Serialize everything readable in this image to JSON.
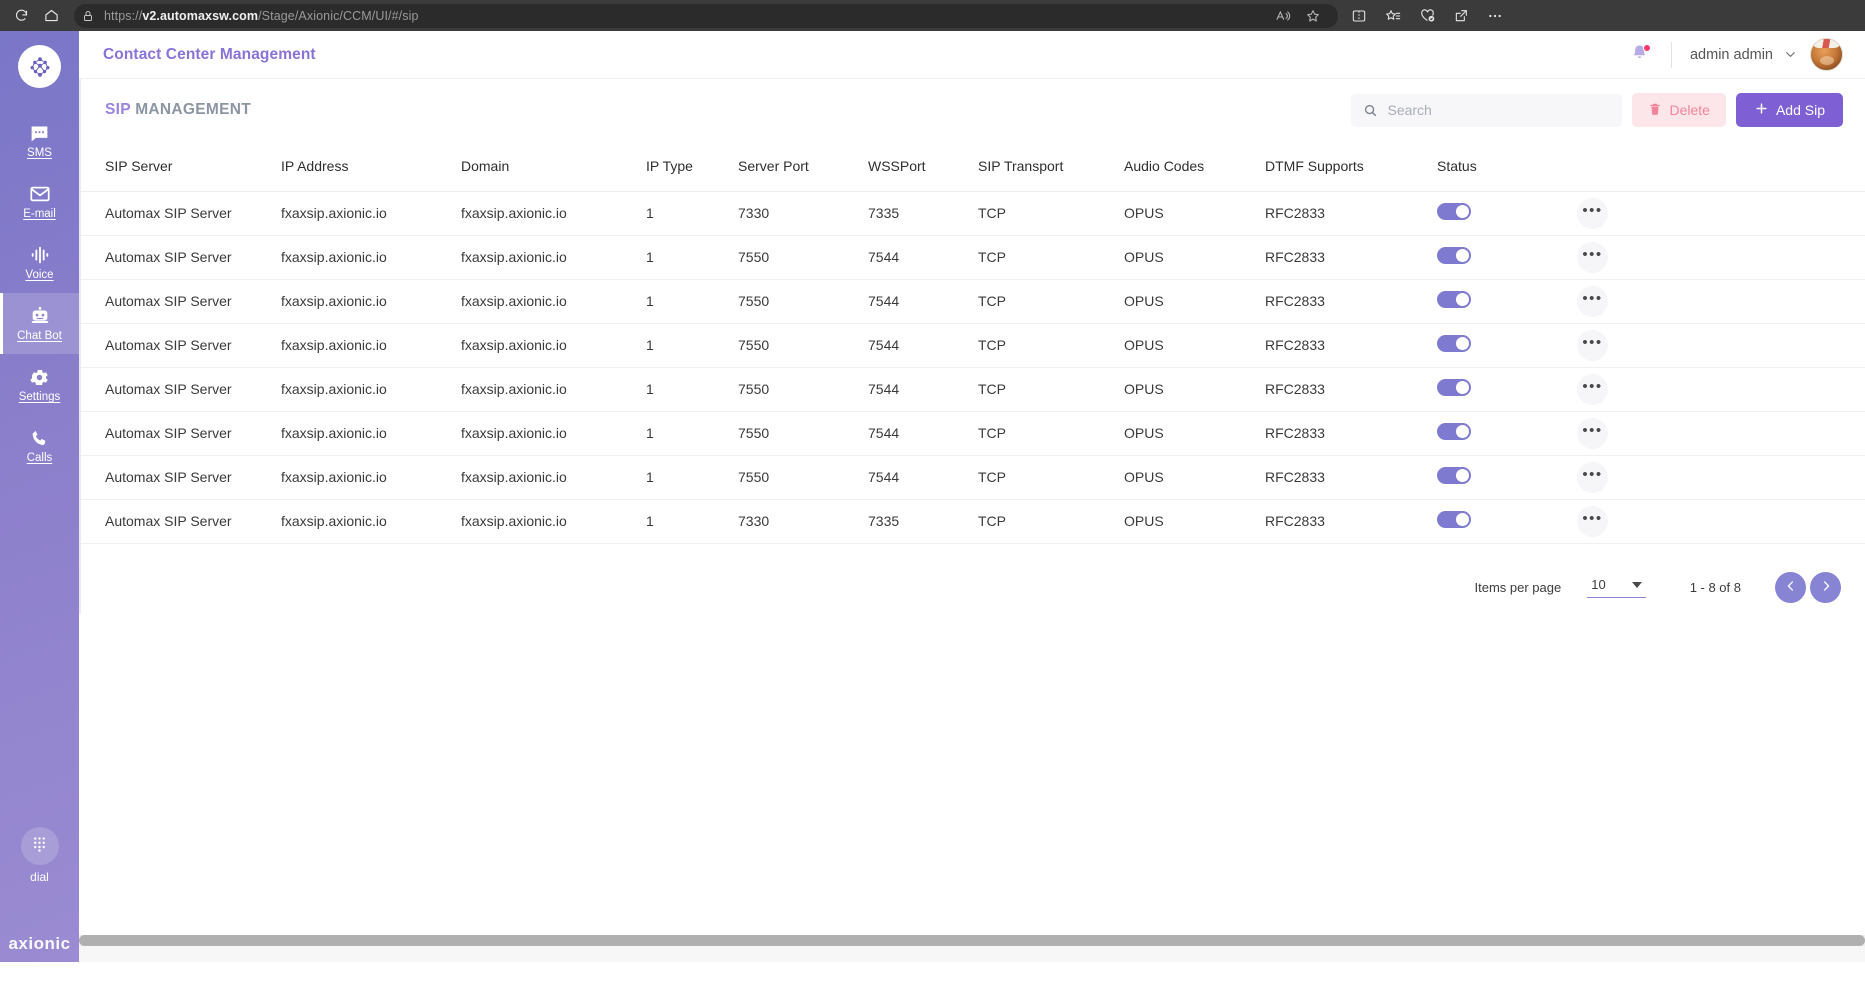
{
  "browser": {
    "url_scheme": "https://",
    "url_host": "v2.automaxsw.com",
    "url_path": "/Stage/Axionic/CCM/UI/#/sip",
    "icons": {
      "refresh": "refresh-icon",
      "home": "home-icon",
      "lock": "lock-icon",
      "read_aloud": "read-aloud-icon",
      "favorite": "star-icon",
      "split_screen": "split-screen-icon",
      "favorites_list": "favorites-list-icon",
      "collections": "collections-icon",
      "share": "share-icon",
      "settings_more": "ellipsis-icon"
    }
  },
  "sidebar": {
    "logo": "axionic-logo-icon",
    "items": [
      {
        "label": "SMS",
        "icon": "sms-icon",
        "active": false
      },
      {
        "label": "E-mail",
        "icon": "email-icon",
        "active": false
      },
      {
        "label": "Voice",
        "icon": "voice-waveform-icon",
        "active": false
      },
      {
        "label": "Chat Bot",
        "icon": "robot-icon",
        "active": true
      },
      {
        "label": "Settings",
        "icon": "gear-icon",
        "active": false
      },
      {
        "label": "Calls",
        "icon": "phone-icon",
        "active": false
      }
    ],
    "dial_label": "dial",
    "dial_icon": "keypad-icon",
    "footer_logo": "axionic"
  },
  "header": {
    "title": "Contact Center Management",
    "bell_icon": "bell-icon",
    "user_name": "admin admin",
    "chevron_icon": "chevron-down-icon",
    "avatar": "cat-avatar"
  },
  "toolbar": {
    "title_accent": "SIP",
    "title_plain": "MANAGEMENT",
    "search_placeholder": "Search",
    "search_value": "",
    "search_icon": "search-icon",
    "delete_label": "Delete",
    "delete_icon": "trash-icon",
    "add_label": "Add Sip",
    "add_icon": "plus-icon"
  },
  "table": {
    "columns": [
      "SIP Server",
      "IP Address",
      "Domain",
      "IP Type",
      "Server Port",
      "WSSPort",
      "SIP Transport",
      "Audio Codes",
      "DTMF Supports",
      "Status"
    ],
    "rows": [
      {
        "server": "Automax SIP Server",
        "ip": "fxaxsip.axionic.io",
        "domain": "fxaxsip.axionic.io",
        "iptype": "1",
        "port": "7330",
        "wss": "7335",
        "transport": "TCP",
        "audio": "OPUS",
        "dtmf": "RFC2833",
        "status": true
      },
      {
        "server": "Automax SIP Server",
        "ip": "fxaxsip.axionic.io",
        "domain": "fxaxsip.axionic.io",
        "iptype": "1",
        "port": "7550",
        "wss": "7544",
        "transport": "TCP",
        "audio": "OPUS",
        "dtmf": "RFC2833",
        "status": true
      },
      {
        "server": "Automax SIP Server",
        "ip": "fxaxsip.axionic.io",
        "domain": "fxaxsip.axionic.io",
        "iptype": "1",
        "port": "7550",
        "wss": "7544",
        "transport": "TCP",
        "audio": "OPUS",
        "dtmf": "RFC2833",
        "status": true
      },
      {
        "server": "Automax SIP Server",
        "ip": "fxaxsip.axionic.io",
        "domain": "fxaxsip.axionic.io",
        "iptype": "1",
        "port": "7550",
        "wss": "7544",
        "transport": "TCP",
        "audio": "OPUS",
        "dtmf": "RFC2833",
        "status": true
      },
      {
        "server": "Automax SIP Server",
        "ip": "fxaxsip.axionic.io",
        "domain": "fxaxsip.axionic.io",
        "iptype": "1",
        "port": "7550",
        "wss": "7544",
        "transport": "TCP",
        "audio": "OPUS",
        "dtmf": "RFC2833",
        "status": true
      },
      {
        "server": "Automax SIP Server",
        "ip": "fxaxsip.axionic.io",
        "domain": "fxaxsip.axionic.io",
        "iptype": "1",
        "port": "7550",
        "wss": "7544",
        "transport": "TCP",
        "audio": "OPUS",
        "dtmf": "RFC2833",
        "status": true
      },
      {
        "server": "Automax SIP Server",
        "ip": "fxaxsip.axionic.io",
        "domain": "fxaxsip.axionic.io",
        "iptype": "1",
        "port": "7550",
        "wss": "7544",
        "transport": "TCP",
        "audio": "OPUS",
        "dtmf": "RFC2833",
        "status": true
      },
      {
        "server": "Automax SIP Server",
        "ip": "fxaxsip.axionic.io",
        "domain": "fxaxsip.axionic.io",
        "iptype": "1",
        "port": "7330",
        "wss": "7335",
        "transport": "TCP",
        "audio": "OPUS",
        "dtmf": "RFC2833",
        "status": true
      }
    ],
    "row_menu_icon": "ellipsis-icon"
  },
  "paginator": {
    "items_per_page_label": "Items per page",
    "page_size": "10",
    "range_label": "1 - 8 of 8",
    "prev_icon": "chevron-left-icon",
    "next_icon": "chevron-right-icon"
  },
  "colors": {
    "accent_purple": "#7e5fd4",
    "title_purple": "#9a82dd",
    "delete_pink": "#f2849a",
    "toggle_on": "#7e7ad0",
    "sidebar_gradient_start": "#7a76c8",
    "sidebar_gradient_end": "#9a8bd2"
  }
}
